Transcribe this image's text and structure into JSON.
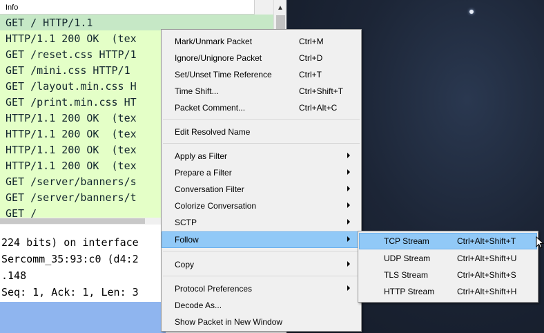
{
  "packet_list": {
    "column_header": "Info",
    "rows": [
      "GET / HTTP/1.1",
      "HTTP/1.1 200 OK  (tex",
      "GET /reset.css HTTP/1",
      "GET /mini.css HTTP/1",
      "GET /layout.min.css H",
      "GET /print.min.css HT",
      "HTTP/1.1 200 OK  (tex",
      "HTTP/1.1 200 OK  (tex",
      "HTTP/1.1 200 OK  (tex",
      "HTTP/1.1 200 OK  (tex",
      "GET /server/banners/s",
      "GET /server/banners/t",
      "GET /"
    ],
    "row_color": "#e4ffc7",
    "selected_row_color": "#c6e8c6"
  },
  "details": {
    "lines": [
      "224 bits) on interface",
      "Sercomm_35:93:c0 (d4:2",
      ".148",
      "Seq: 1, Ack: 1, Len: 3"
    ]
  },
  "context_menu": {
    "items": [
      {
        "label": "Mark/Unmark Packet",
        "shortcut": "Ctrl+M"
      },
      {
        "label": "Ignore/Unignore Packet",
        "shortcut": "Ctrl+D"
      },
      {
        "label": "Set/Unset Time Reference",
        "shortcut": "Ctrl+T"
      },
      {
        "label": "Time Shift...",
        "shortcut": "Ctrl+Shift+T"
      },
      {
        "label": "Packet Comment...",
        "shortcut": "Ctrl+Alt+C"
      },
      {
        "label": "Edit Resolved Name",
        "shortcut": ""
      },
      {
        "label": "Apply as Filter",
        "shortcut": ""
      },
      {
        "label": "Prepare a Filter",
        "shortcut": ""
      },
      {
        "label": "Conversation Filter",
        "shortcut": ""
      },
      {
        "label": "Colorize Conversation",
        "shortcut": ""
      },
      {
        "label": "SCTP",
        "shortcut": ""
      },
      {
        "label": "Follow",
        "shortcut": ""
      },
      {
        "label": "Copy",
        "shortcut": ""
      },
      {
        "label": "Protocol Preferences",
        "shortcut": ""
      },
      {
        "label": "Decode As...",
        "shortcut": ""
      },
      {
        "label": "Show Packet in New Window",
        "shortcut": ""
      }
    ],
    "highlight_color": "#91c9f7"
  },
  "follow_submenu": {
    "items": [
      {
        "label": "TCP Stream",
        "shortcut": "Ctrl+Alt+Shift+T"
      },
      {
        "label": "UDP Stream",
        "shortcut": "Ctrl+Alt+Shift+U"
      },
      {
        "label": "TLS Stream",
        "shortcut": "Ctrl+Alt+Shift+S"
      },
      {
        "label": "HTTP Stream",
        "shortcut": "Ctrl+Alt+Shift+H"
      }
    ]
  },
  "icons": {
    "scroll_up": "up-arrow-icon",
    "submenu_arrow": "chevron-right-icon",
    "cursor": "arrow-cursor-icon"
  }
}
